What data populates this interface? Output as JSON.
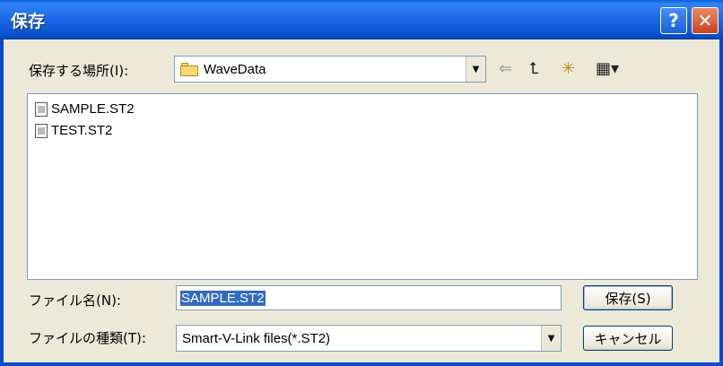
{
  "window": {
    "title": "保存",
    "help_glyph": "?",
    "close_glyph": "✕"
  },
  "location": {
    "label": "保存する場所(I):",
    "current_folder": "WaveData"
  },
  "toolbar": {
    "back_glyph": "⇐",
    "up_glyph": "⮤",
    "new_folder_glyph": "✳",
    "view_glyph": "▦▾"
  },
  "files": [
    {
      "name": "SAMPLE.ST2"
    },
    {
      "name": "TEST.ST2"
    }
  ],
  "filename": {
    "label": "ファイル名(N):",
    "value": "SAMPLE.ST2"
  },
  "filetype": {
    "label": "ファイルの種類(T):",
    "value": "Smart-V-Link files(*.ST2)"
  },
  "buttons": {
    "save": "保存(S)",
    "cancel": "キャンセル"
  },
  "colors": {
    "titlebar": "#0a5fd8",
    "selection": "#316ac5"
  }
}
